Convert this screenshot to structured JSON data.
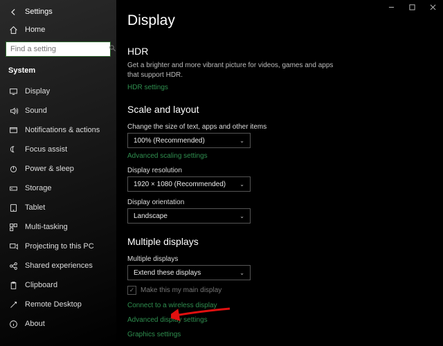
{
  "window": {
    "title": "Settings"
  },
  "sidebar": {
    "home": "Home",
    "search_placeholder": "Find a setting",
    "section": "System",
    "items": [
      {
        "icon": "display",
        "label": "Display"
      },
      {
        "icon": "sound",
        "label": "Sound"
      },
      {
        "icon": "notifications",
        "label": "Notifications & actions"
      },
      {
        "icon": "focus",
        "label": "Focus assist"
      },
      {
        "icon": "power",
        "label": "Power & sleep"
      },
      {
        "icon": "storage",
        "label": "Storage"
      },
      {
        "icon": "tablet",
        "label": "Tablet"
      },
      {
        "icon": "multitask",
        "label": "Multi-tasking"
      },
      {
        "icon": "project",
        "label": "Projecting to this PC"
      },
      {
        "icon": "shared",
        "label": "Shared experiences"
      },
      {
        "icon": "clipboard",
        "label": "Clipboard"
      },
      {
        "icon": "remote",
        "label": "Remote Desktop"
      },
      {
        "icon": "about",
        "label": "About"
      }
    ]
  },
  "page": {
    "title": "Display",
    "hdr": {
      "heading": "HDR",
      "desc": "Get a brighter and more vibrant picture for videos, games and apps that support HDR.",
      "link": "HDR settings"
    },
    "scale": {
      "heading": "Scale and layout",
      "size_label": "Change the size of text, apps and other items",
      "size_value": "100% (Recommended)",
      "adv_link": "Advanced scaling settings",
      "res_label": "Display resolution",
      "res_value": "1920 × 1080 (Recommended)",
      "orient_label": "Display orientation",
      "orient_value": "Landscape"
    },
    "multi": {
      "heading": "Multiple displays",
      "label": "Multiple displays",
      "value": "Extend these displays",
      "checkbox": "Make this my main display",
      "link1": "Connect to a wireless display",
      "link2": "Advanced display settings",
      "link3": "Graphics settings"
    }
  }
}
